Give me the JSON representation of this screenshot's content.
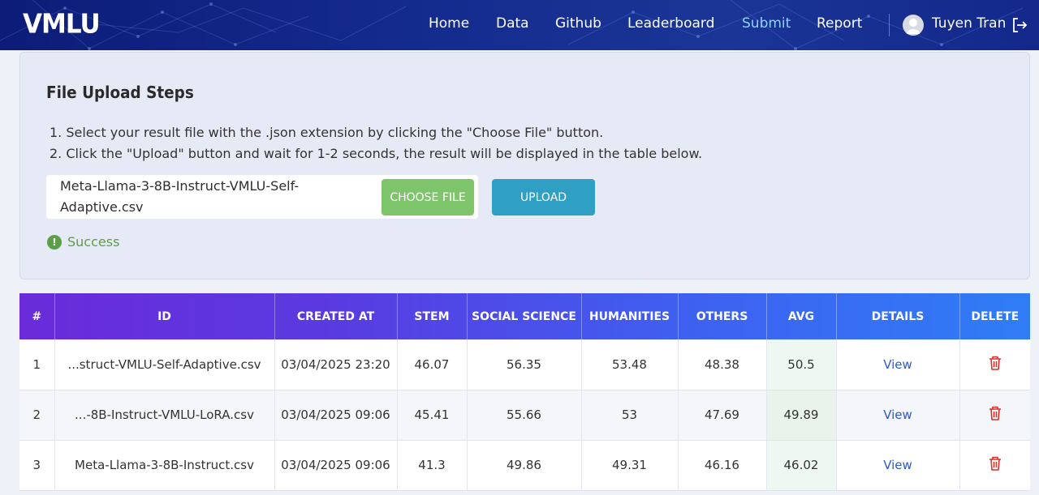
{
  "nav": {
    "logo": "VMLU",
    "links": [
      "Home",
      "Data",
      "Github",
      "Leaderboard",
      "Submit",
      "Report"
    ],
    "active": "Submit",
    "user_name": "Tuyen Tran"
  },
  "upload": {
    "title": "File Upload Steps",
    "step1": "1. Select your result file with the .json extension by clicking the \"Choose File\" button.",
    "step2": "2. Click the \"Upload\" button and wait for 1-2 seconds, the result will be displayed in the table below.",
    "file_name": "Meta-Llama-3-8B-Instruct-VMLU-Self-Adaptive.csv",
    "choose_label": "CHOOSE FILE",
    "upload_label": "UPLOAD",
    "status_icon": "!",
    "status_text": "Success"
  },
  "table": {
    "headers": [
      "#",
      "ID",
      "CREATED AT",
      "STEM",
      "SOCIAL SCIENCE",
      "HUMANITIES",
      "OTHERS",
      "AVG",
      "DETAILS",
      "DELETE"
    ],
    "view_label": "View",
    "rows": [
      {
        "num": "1",
        "id": "...struct-VMLU-Self-Adaptive.csv",
        "created": "03/04/2025 23:20",
        "stem": "46.07",
        "social": "56.35",
        "humanities": "53.48",
        "others": "48.38",
        "avg": "50.5"
      },
      {
        "num": "2",
        "id": "...-8B-Instruct-VMLU-LoRA.csv",
        "created": "03/04/2025 09:06",
        "stem": "45.41",
        "social": "55.66",
        "humanities": "53",
        "others": "47.69",
        "avg": "49.89"
      },
      {
        "num": "3",
        "id": "Meta-Llama-3-8B-Instruct.csv",
        "created": "03/04/2025 09:06",
        "stem": "41.3",
        "social": "49.86",
        "humanities": "49.31",
        "others": "46.16",
        "avg": "46.02"
      }
    ]
  },
  "colors": {
    "nav_bg": "#13288a",
    "active_link": "#8fd3ff",
    "choose_button": "#7ec46a",
    "upload_button": "#2f9fc3",
    "success": "#5a9e47",
    "view_link": "#2f58c8",
    "delete_icon": "#d9302c"
  }
}
